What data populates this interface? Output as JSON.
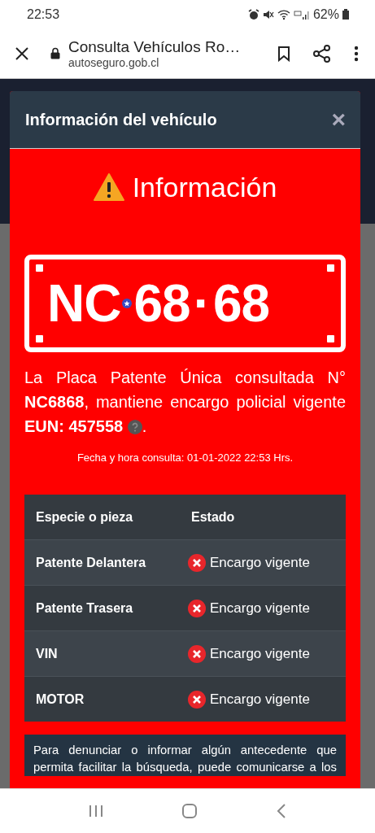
{
  "status_bar": {
    "time": "22:53",
    "battery": "62%"
  },
  "browser": {
    "title": "Consulta Vehículos Ro…",
    "url": "autoseguro.gob.cl"
  },
  "modal": {
    "title": "Información del vehículo",
    "close": "×",
    "heading": "Información",
    "plate": {
      "letters": "NC",
      "group_1": "68",
      "separator": "·",
      "group_2": "68"
    },
    "message": "La Placa Patente Única consultada N° **NC6868**, mantiene encargo policial vigente **EUN: 457558**",
    "message_end": ".",
    "timestamp": "Fecha y hora consulta: 01-01-2022 22:53 Hrs.",
    "table": {
      "columns": [
        "Especie o pieza",
        "Estado"
      ],
      "rows": [
        {
          "item": "Patente Delantera",
          "status": "Encargo vigente",
          "kind": "alert"
        },
        {
          "item": "Patente Trasera",
          "status": "Encargo vigente",
          "kind": "alert"
        },
        {
          "item": "VIN",
          "status": "Encargo vigente",
          "kind": "alert"
        },
        {
          "item": "MOTOR",
          "status": "Encargo vigente",
          "kind": "alert"
        }
      ]
    },
    "notice": "Para denunciar o informar algún antecedente que permita facilitar la búsqueda, puede comunicarse a los"
  }
}
